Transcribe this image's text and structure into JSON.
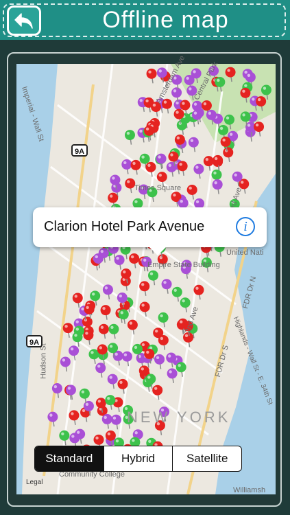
{
  "header": {
    "title": "Offline map",
    "back_icon": "back-arrow-icon"
  },
  "map": {
    "labels": [
      "United Nati",
      "FDR Dr N",
      "FDR Dr S",
      "Highlands - Wall St - E. 34th St",
      "Hudson St",
      "Imperial - Wall St",
      "Community College",
      "Williamsh",
      "2nd Ave",
      "3rd Ave",
      "Central Park",
      "Amsterdam Ave",
      "NEW YORK",
      "Times Square",
      "Empire State Building"
    ],
    "highway": "9A",
    "pin_colors": [
      "#e52320",
      "#a94fd6",
      "#3dc24b"
    ]
  },
  "callout": {
    "title": "Clarion Hotel Park Avenue",
    "info_icon": "info-icon"
  },
  "segmented": {
    "items": [
      "Standard",
      "Hybrid",
      "Satellite"
    ],
    "selected": "Standard"
  },
  "legal": "Legal"
}
